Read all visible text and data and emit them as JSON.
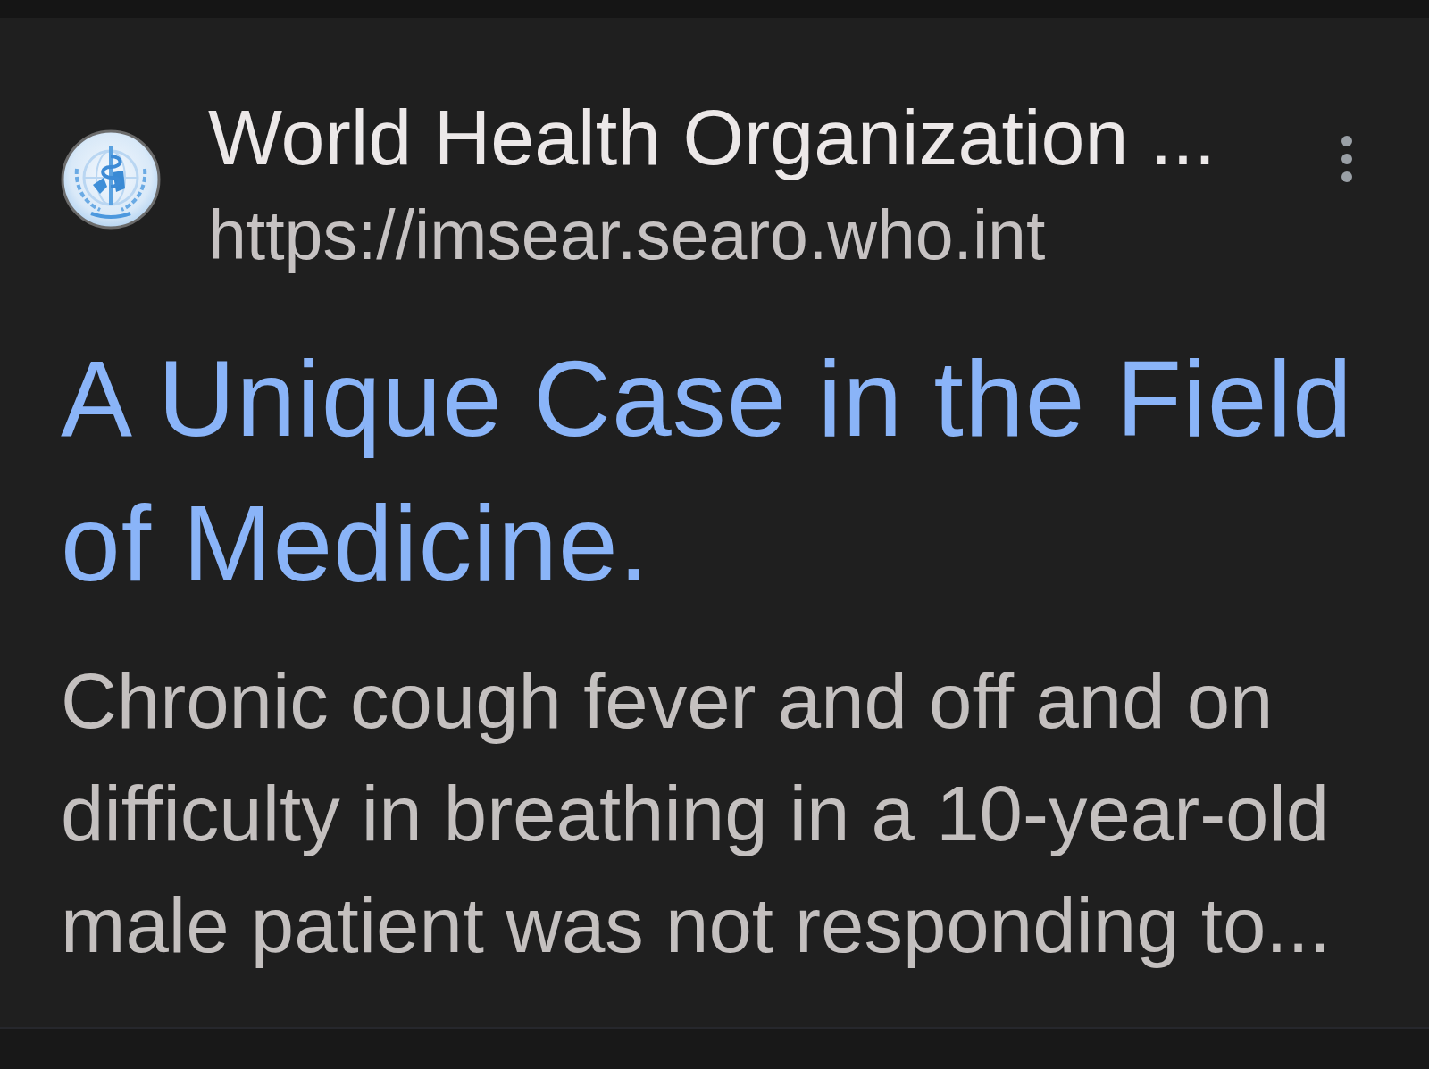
{
  "result": {
    "site_name": "World Health Organization ...",
    "url": "https://imsear.searo.who.int",
    "title": "A Unique Case in the Field of Medicine.",
    "snippet": "Chronic cough fever and off and on difficulty in breathing in a 10-year-old male patient was not responding to..."
  }
}
